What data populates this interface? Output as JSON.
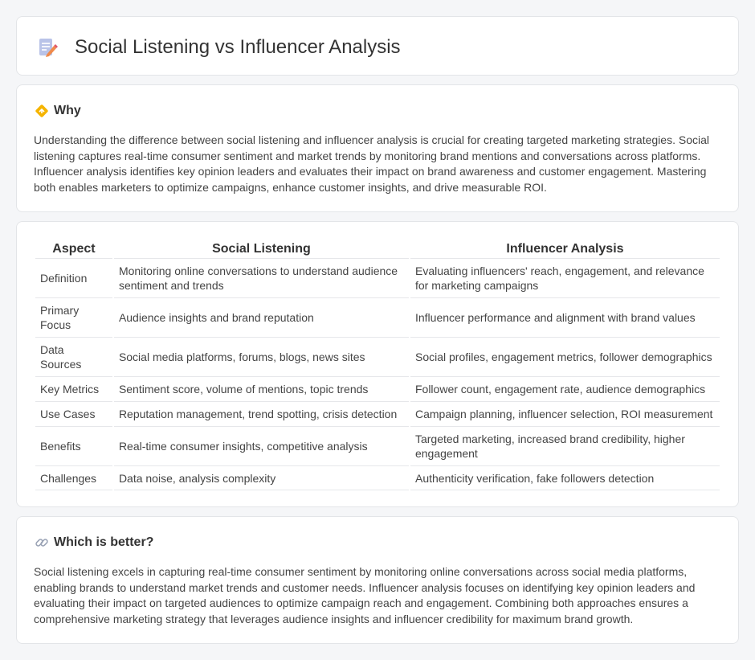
{
  "header": {
    "title": "Social Listening vs Influencer Analysis",
    "icon": "document-pencil-icon"
  },
  "why": {
    "heading": "Why",
    "icon": "diamond-arrow-icon",
    "text": "Understanding the difference between social listening and influencer analysis is crucial for creating targeted marketing strategies. Social listening captures real-time consumer sentiment and market trends by monitoring brand mentions and conversations across platforms. Influencer analysis identifies key opinion leaders and evaluates their impact on brand awareness and customer engagement. Mastering both enables marketers to optimize campaigns, enhance customer insights, and drive measurable ROI."
  },
  "table": {
    "headers": [
      "Aspect",
      "Social Listening",
      "Influencer Analysis"
    ],
    "rows": [
      {
        "aspect": "Definition",
        "social": "Monitoring online conversations to understand audience sentiment and trends",
        "influencer": "Evaluating influencers' reach, engagement, and relevance for marketing campaigns"
      },
      {
        "aspect": "Primary Focus",
        "social": "Audience insights and brand reputation",
        "influencer": "Influencer performance and alignment with brand values"
      },
      {
        "aspect": "Data Sources",
        "social": "Social media platforms, forums, blogs, news sites",
        "influencer": "Social profiles, engagement metrics, follower demographics"
      },
      {
        "aspect": "Key Metrics",
        "social": "Sentiment score, volume of mentions, topic trends",
        "influencer": "Follower count, engagement rate, audience demographics"
      },
      {
        "aspect": "Use Cases",
        "social": "Reputation management, trend spotting, crisis detection",
        "influencer": "Campaign planning, influencer selection, ROI measurement"
      },
      {
        "aspect": "Benefits",
        "social": "Real-time consumer insights, competitive analysis",
        "influencer": "Targeted marketing, increased brand credibility, higher engagement"
      },
      {
        "aspect": "Challenges",
        "social": "Data noise, analysis complexity",
        "influencer": "Authenticity verification, fake followers detection"
      }
    ]
  },
  "better": {
    "heading": "Which is better?",
    "icon": "link-icon",
    "text": "Social listening excels in capturing real-time consumer sentiment by monitoring online conversations across social media platforms, enabling brands to understand market trends and customer needs. Influencer analysis focuses on identifying key opinion leaders and evaluating their impact on targeted audiences to optimize campaign reach and engagement. Combining both approaches ensures a comprehensive marketing strategy that leverages audience insights and influencer credibility for maximum brand growth."
  }
}
